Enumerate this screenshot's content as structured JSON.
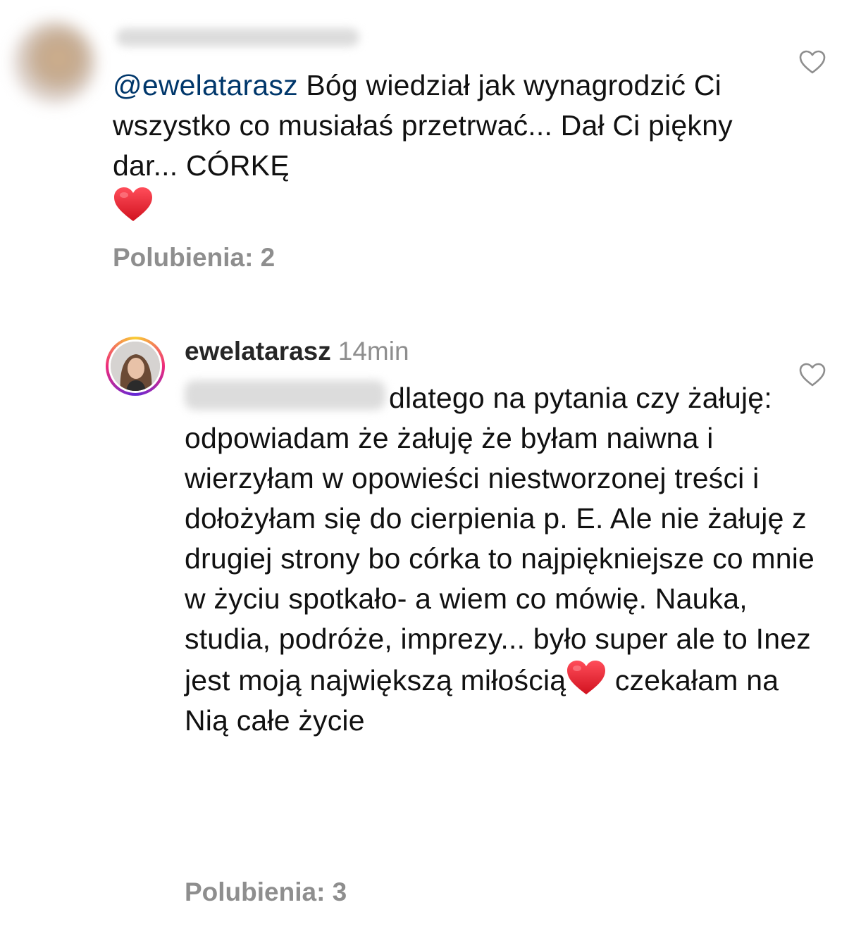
{
  "comments": [
    {
      "mention": "@ewelatarasz",
      "text": " Bóg wiedział jak wynagrodzić Ci wszystko co musiałaś przetrwać... Dał Ci piękny dar... CÓRKĘ",
      "likes_label": "Polubienia: 2"
    },
    {
      "username": "ewelatarasz",
      "time": "14min",
      "text": "dlatego na pytania czy żałuję: odpowiadam że żałuję że byłam naiwna i wierzyłam w opowieści niestworzonej treści i dołożyłam się do cierpienia p. E. Ale nie żałuję z drugiej strony bo córka to najpiękniejsze co mnie w życiu spotkało- a wiem co mówię. Nauka, studia, podróże, imprezy... było super ale to Inez jest moją największą miłością",
      "text_after_heart": " czekałam na Nią całe życie",
      "likes_label": "Polubienia: 3"
    }
  ],
  "icons": {
    "like": "heart-outline-icon",
    "emoji": "red-heart-emoji"
  },
  "colors": {
    "mention": "#00376b",
    "secondary": "#8e8e8e",
    "heart_red": "#e02431"
  }
}
